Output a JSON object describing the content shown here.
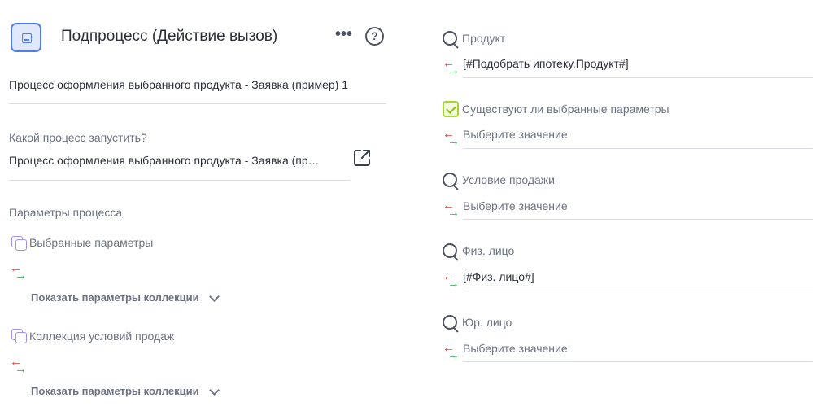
{
  "header": {
    "title": "Подпроцесс (Действие вызов)",
    "more": "•••",
    "help": "?"
  },
  "left": {
    "process_name": "Процесс оформления выбранного продукта - Заявка (пример) 1",
    "which_process_label": "Какой процесс запустить?",
    "which_process_value": "Процесс оформления выбранного продукта - Заявка (пр…",
    "params_heading": "Параметры процесса",
    "collections": [
      {
        "label": "Выбранные параметры",
        "show_label": "Показать параметры коллекции"
      },
      {
        "label": "Коллекция условий продаж",
        "show_label": "Показать параметры коллекции"
      }
    ]
  },
  "right": {
    "params": [
      {
        "icon": "search-icon",
        "label": "Продукт",
        "value": "[#Подобрать ипотеку.Продукт#]",
        "is_placeholder": false
      },
      {
        "icon": "checkbox-icon",
        "label": "Существуют ли выбранные параметры",
        "value": "Выберите значение",
        "is_placeholder": true
      },
      {
        "icon": "search-icon",
        "label": "Условие продажи",
        "value": "Выберите значение",
        "is_placeholder": true
      },
      {
        "icon": "search-icon",
        "label": "Физ. лицо",
        "value": "[#Физ. лицо#]",
        "is_placeholder": false
      },
      {
        "icon": "search-icon",
        "label": "Юр. лицо",
        "value": "Выберите значение",
        "is_placeholder": true
      }
    ]
  },
  "colors": {
    "accent_blue": "#4f7ee6",
    "collection_purple": "#a28ef1",
    "arrow_red": "#e53935",
    "arrow_green": "#2ea44f",
    "check_green": "#a6d82b"
  }
}
